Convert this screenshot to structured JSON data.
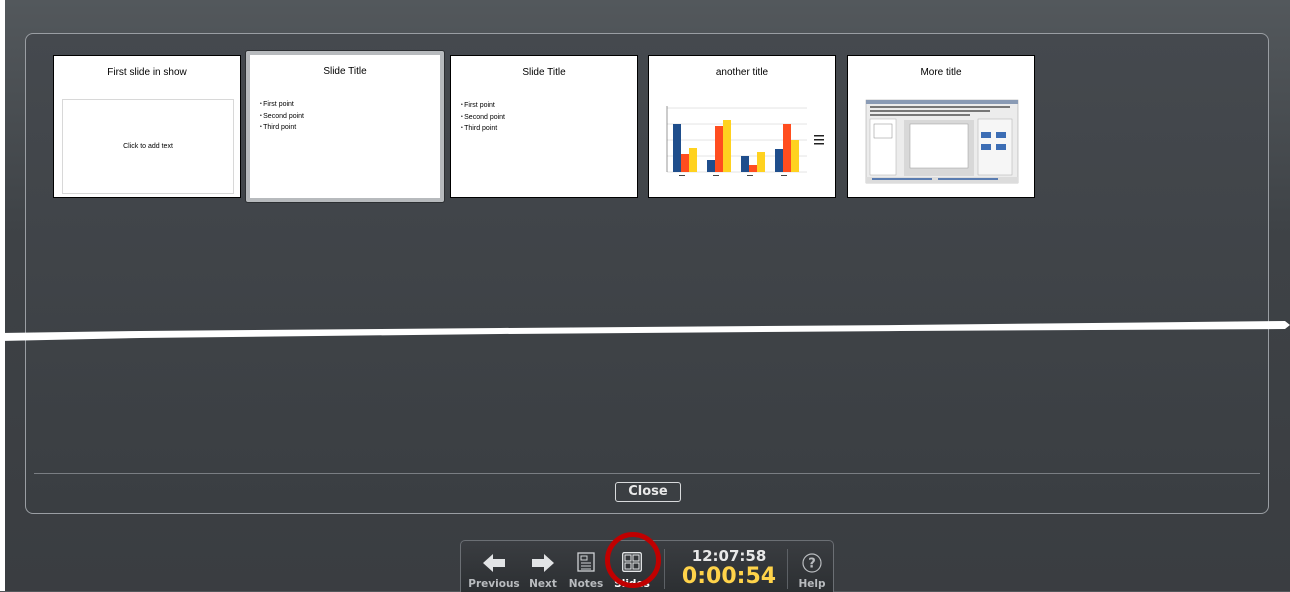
{
  "slides": [
    {
      "title": "First slide in show",
      "placeholder": "Click to add text"
    },
    {
      "title": "Slide Title",
      "bullets": [
        "First point",
        "Second point",
        "Third point"
      ]
    },
    {
      "title": "Slide Title",
      "bullets": [
        "First point",
        "Second point",
        "Third point"
      ]
    },
    {
      "title": "another title"
    },
    {
      "title": "More title"
    }
  ],
  "current_slide_index": 1,
  "close_label": "Close",
  "toolbar": {
    "previous_label": "Previous",
    "next_label": "Next",
    "notes_label": "Notes",
    "slides_label": "Slides",
    "clock": "12:07:58",
    "timer": "0:00:54",
    "help_label": "Help"
  },
  "colors": {
    "chart_blue": "#1f4e8c",
    "chart_orange": "#ff4d1f",
    "chart_yellow": "#ffd21f",
    "timer": "#ffd34a",
    "highlight": "#c00000"
  }
}
